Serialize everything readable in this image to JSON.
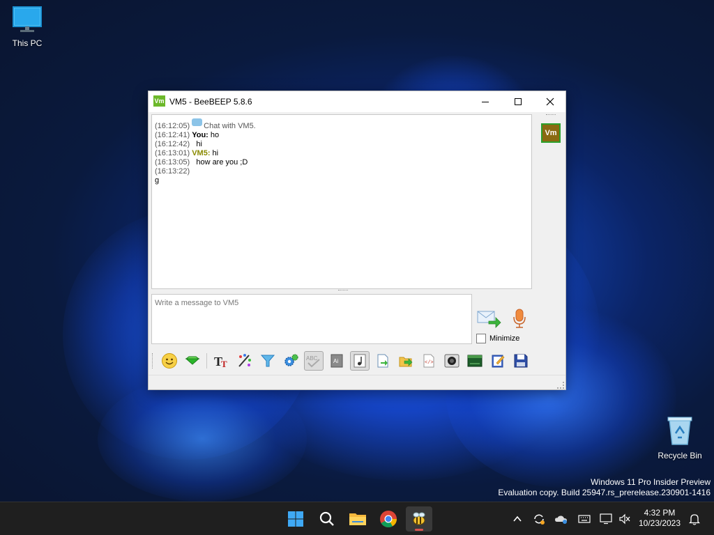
{
  "desktop": {
    "icons": [
      {
        "label": "This PC",
        "icon": "monitor-icon"
      },
      {
        "label": "Recycle Bin",
        "icon": "recycle-bin-icon"
      }
    ],
    "watermark_line1": "Windows 11 Pro Insider Preview",
    "watermark_line2": "Evaluation copy. Build 25947.rs_prerelease.230901-1416"
  },
  "window": {
    "app_icon_text": "Vm",
    "title": "VM5 - BeeBEEP 5.8.6",
    "chat": [
      {
        "time": "(16:12:05)",
        "sender": "",
        "text": "Chat with VM5."
      },
      {
        "time": "(16:12:41)",
        "sender": "You:",
        "text": " ho"
      },
      {
        "time": "(16:12:42)",
        "sender": "",
        "text": "hi"
      },
      {
        "time": "(16:13:01)",
        "sender": "VM5:",
        "text": " hi"
      },
      {
        "time": "(16:13:05)",
        "sender": "",
        "text": "how are you ;D"
      },
      {
        "time": "(16:13:22)",
        "sender": "",
        "text": ""
      },
      {
        "time": "",
        "sender": "",
        "text": "g"
      }
    ],
    "composer_placeholder": "Write a message to VM5",
    "minimize_label": "Minimize",
    "user_avatar_text": "Vm",
    "toolbar_icons": [
      "emoticon-icon",
      "gem-icon",
      "font-icon",
      "color-palette-icon",
      "filter-icon",
      "settings-gears-icon",
      "spell-check-icon",
      "dictionary-icon",
      "music-note-icon",
      "save-chat-icon",
      "send-file-icon",
      "html-code-icon",
      "screenshot-icon",
      "terminal-icon",
      "edit-note-icon",
      "save-disk-icon"
    ]
  },
  "taskbar": {
    "apps": [
      "windows-start-icon",
      "search-icon",
      "file-explorer-icon",
      "chrome-icon",
      "beebeep-icon"
    ],
    "tray": [
      "chevron-up-icon",
      "sync-icon",
      "onedrive-icon",
      "keyboard-icon",
      "display-icon",
      "volume-muted-icon",
      "notification-bell-icon"
    ],
    "time": "4:32 PM",
    "date": "10/23/2023"
  }
}
